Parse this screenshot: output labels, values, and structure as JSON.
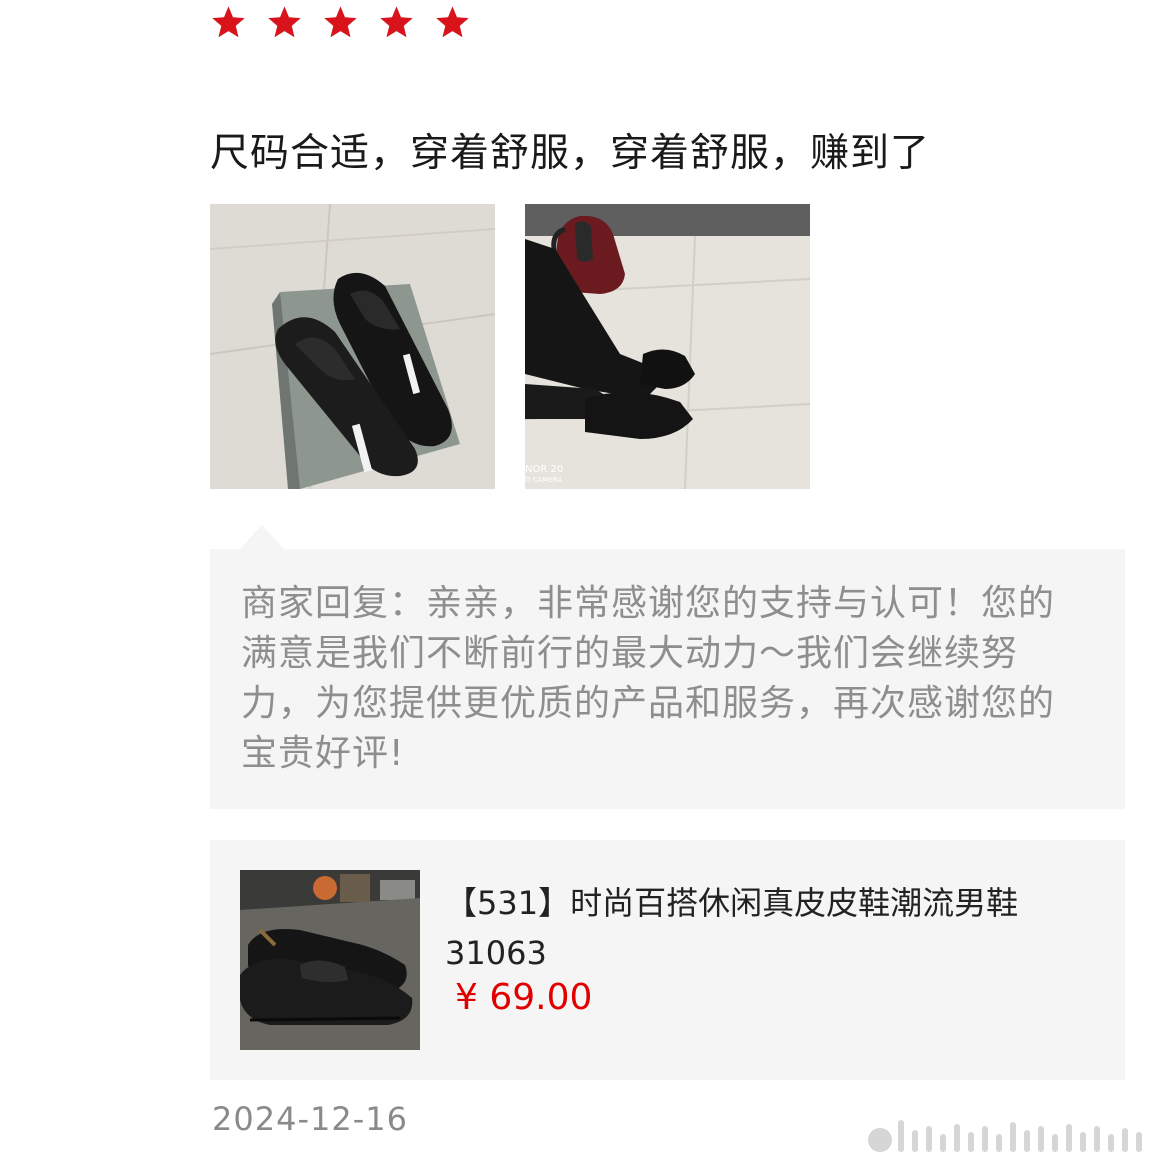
{
  "review": {
    "rating": 5,
    "rating_max": 5,
    "star_color": "#d9131b",
    "text": "尺码合适，穿着舒服，穿着舒服，赚到了",
    "photos": [
      {
        "icon": "photo-shoes-on-box"
      },
      {
        "icon": "photo-worn-shoes",
        "overlay_line1": "NOR 20",
        "overlay_line2": "D CAMERA"
      }
    ]
  },
  "merchant_reply": {
    "text": "商家回复：亲亲，非常感谢您的支持与认可！您的满意是我们不断前行的最大动力～我们会继续努力，为您提供更优质的产品和服务，再次感谢您的宝贵好评!"
  },
  "product": {
    "title": "【531】时尚百搭休闲真皮皮鞋潮流男鞋 31063",
    "price": "¥ 69.00",
    "price_color": "#e00000"
  },
  "date": "2024-12-16"
}
